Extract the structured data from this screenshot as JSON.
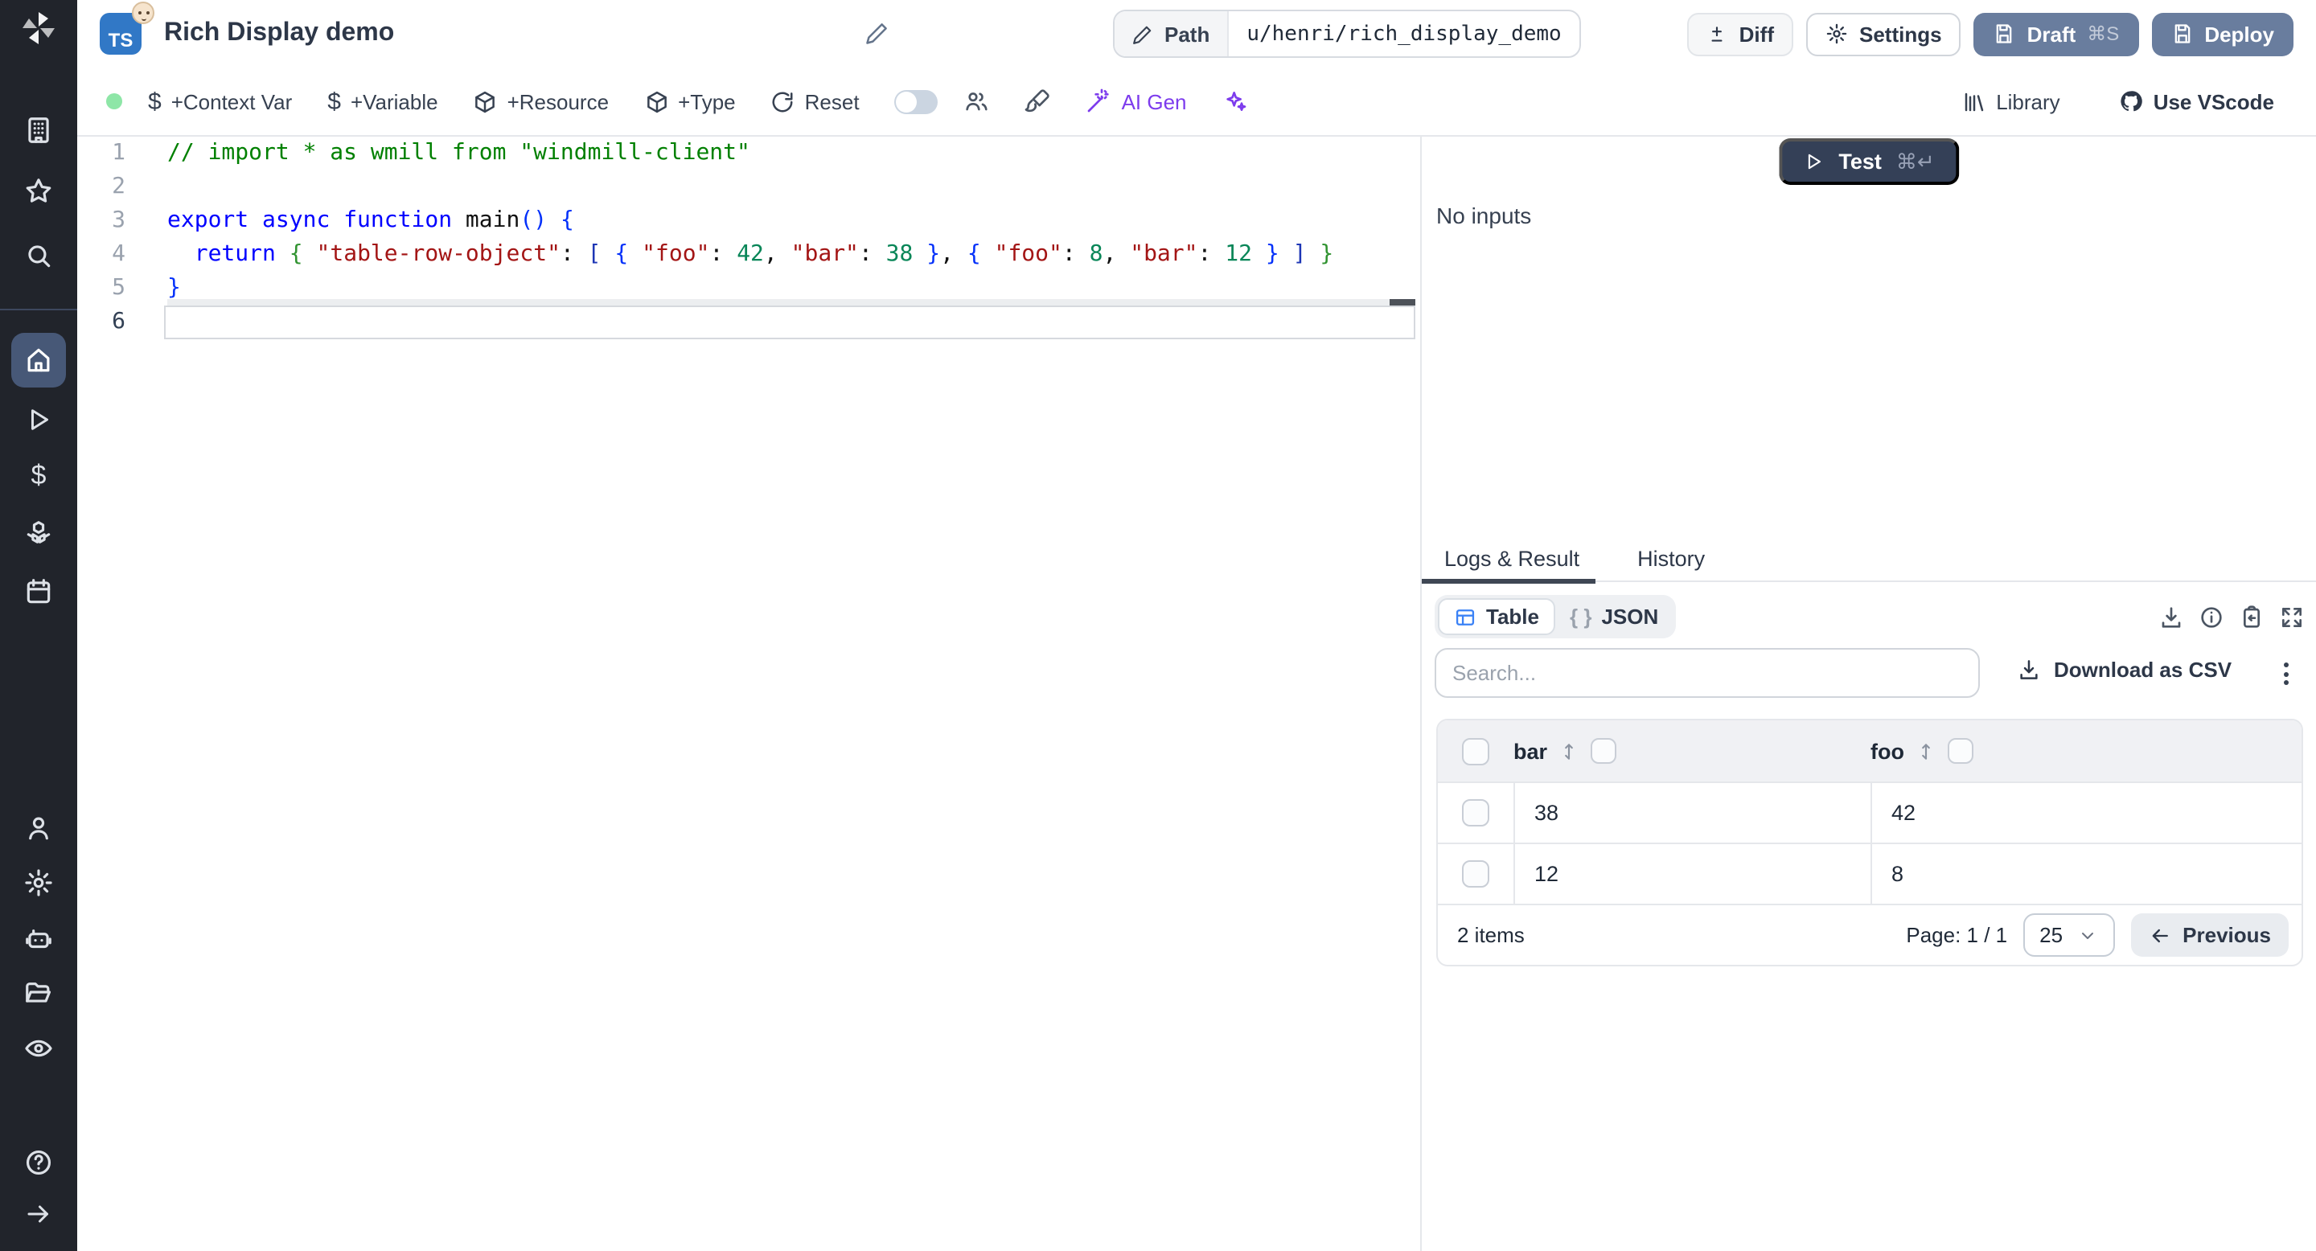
{
  "topbar": {
    "badge": "TS",
    "title": "Rich Display demo",
    "path_label": "Path",
    "path_value": "u/henri/rich_display_demo",
    "diff_label": "Diff",
    "settings_label": "Settings",
    "draft_label": "Draft",
    "draft_shortcut": "⌘S",
    "deploy_label": "Deploy"
  },
  "toolbar": {
    "context_var": "+Context Var",
    "variable": "+Variable",
    "resource": "+Resource",
    "type": "+Type",
    "reset": "Reset",
    "ai_gen": "AI Gen",
    "library": "Library",
    "use_vscode": "Use VScode",
    "dollar": "$",
    "status_color": "#8ee6a7",
    "ai_color": "#7d3ced"
  },
  "sidebar": {
    "icons_top": [
      "building",
      "star",
      "search"
    ],
    "icons_mid": [
      "home",
      "play",
      "dollar",
      "boxes",
      "calendar"
    ],
    "active": "home",
    "icons_bottom": [
      "user",
      "gear",
      "bot",
      "folder",
      "eye"
    ],
    "icons_footer": [
      "help",
      "arrow-right"
    ],
    "active_color": "#475877"
  },
  "editor": {
    "language": "typescript",
    "current_line": 6,
    "lines": [
      {
        "n": "1",
        "tokens": [
          [
            "comment",
            "// import * as wmill from \"windmill-client\""
          ]
        ]
      },
      {
        "n": "2",
        "tokens": []
      },
      {
        "n": "3",
        "tokens": [
          [
            "kw",
            "export "
          ],
          [
            "kw",
            "async "
          ],
          [
            "kw",
            "function "
          ],
          [
            "pl",
            "main"
          ],
          [
            "b1",
            "()"
          ],
          [
            "pl",
            " "
          ],
          [
            "b1",
            "{"
          ]
        ]
      },
      {
        "n": "4",
        "tokens": [
          [
            "pl",
            "  "
          ],
          [
            "kw",
            "return "
          ],
          [
            "b2",
            "{"
          ],
          [
            "pl",
            " "
          ],
          [
            "str",
            "\"table-row-object\""
          ],
          [
            "pl",
            ": "
          ],
          [
            "b3",
            "["
          ],
          [
            "pl",
            " "
          ],
          [
            "b1",
            "{"
          ],
          [
            "pl",
            " "
          ],
          [
            "str",
            "\"foo\""
          ],
          [
            "pl",
            ": "
          ],
          [
            "num",
            "42"
          ],
          [
            "pl",
            ", "
          ],
          [
            "str",
            "\"bar\""
          ],
          [
            "pl",
            ": "
          ],
          [
            "num",
            "38"
          ],
          [
            "pl",
            " "
          ],
          [
            "b1",
            "}"
          ],
          [
            "pl",
            ", "
          ],
          [
            "b1",
            "{"
          ],
          [
            "pl",
            " "
          ],
          [
            "str",
            "\"foo\""
          ],
          [
            "pl",
            ": "
          ],
          [
            "num",
            "8"
          ],
          [
            "pl",
            ", "
          ],
          [
            "str",
            "\"bar\""
          ],
          [
            "pl",
            ": "
          ],
          [
            "num",
            "12"
          ],
          [
            "pl",
            " "
          ],
          [
            "b1",
            "}"
          ],
          [
            "pl",
            " "
          ],
          [
            "b3",
            "]"
          ],
          [
            "pl",
            " "
          ],
          [
            "b2",
            "}"
          ]
        ]
      },
      {
        "n": "5",
        "tokens": [
          [
            "b1",
            "}"
          ]
        ]
      },
      {
        "n": "6",
        "tokens": []
      }
    ]
  },
  "preview": {
    "test_label": "Test",
    "test_shortcut": "⌘↵",
    "no_inputs": "No inputs"
  },
  "result": {
    "tabs": [
      "Logs & Result",
      "History"
    ],
    "active_tab": "Logs & Result",
    "views": [
      "Table",
      "JSON"
    ],
    "active_view": "Table",
    "braces_glyph": "{ }",
    "search_placeholder": "Search...",
    "download_csv_label": "Download as CSV",
    "table": {
      "columns": [
        "bar",
        "foo"
      ],
      "rows": [
        {
          "bar": "38",
          "foo": "42"
        },
        {
          "bar": "12",
          "foo": "8"
        }
      ]
    },
    "footer": {
      "count": "2 items",
      "page": "Page: 1 / 1",
      "page_size": "25",
      "previous_label": "Previous"
    }
  }
}
